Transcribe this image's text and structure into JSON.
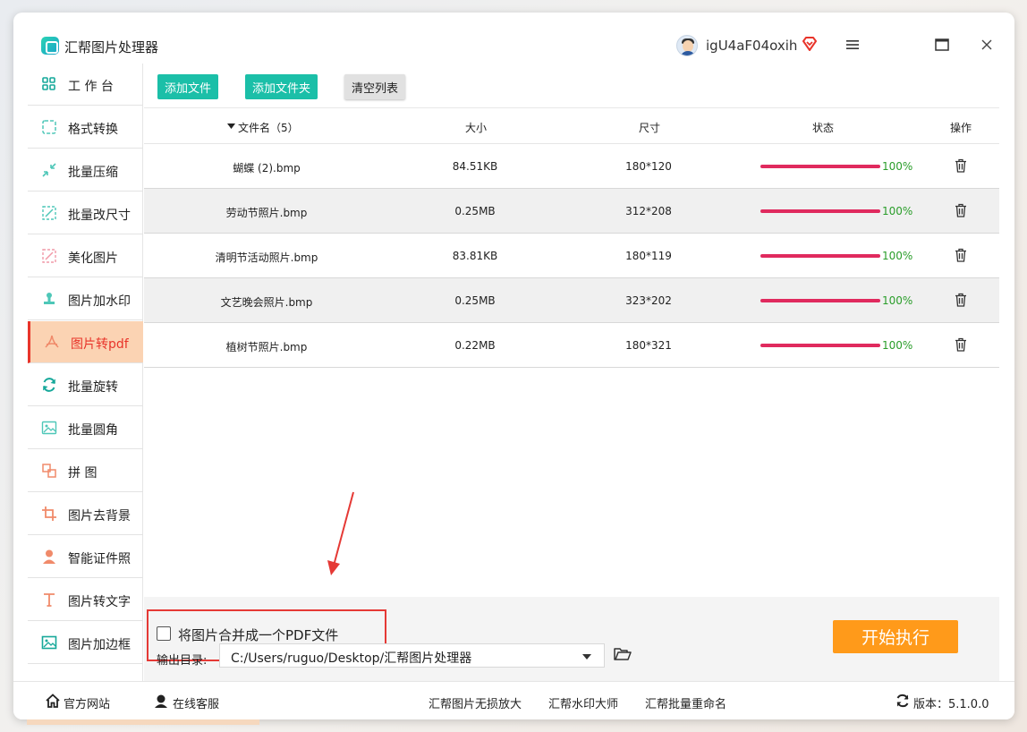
{
  "window": {
    "title": "汇帮图片处理器",
    "username": "igU4aF04oxih"
  },
  "sidebar": {
    "items": [
      {
        "label": "工 作 台",
        "icon": "grid-icon"
      },
      {
        "label": "格式转换",
        "icon": "convert-icon"
      },
      {
        "label": "批量压缩",
        "icon": "compress-icon"
      },
      {
        "label": "批量改尺寸",
        "icon": "resize-icon"
      },
      {
        "label": "美化图片",
        "icon": "beautify-icon"
      },
      {
        "label": "图片加水印",
        "icon": "watermark-icon"
      },
      {
        "label": "图片转pdf",
        "icon": "pdf-icon"
      },
      {
        "label": "批量旋转",
        "icon": "rotate-icon"
      },
      {
        "label": "批量圆角",
        "icon": "round-corner-icon"
      },
      {
        "label": "拼   图",
        "icon": "puzzle-icon"
      },
      {
        "label": "图片去背景",
        "icon": "crop-icon"
      },
      {
        "label": "智能证件照",
        "icon": "person-icon"
      },
      {
        "label": "图片转文字",
        "icon": "text-icon"
      },
      {
        "label": "图片加边框",
        "icon": "frame-icon"
      }
    ],
    "active_index": 6
  },
  "toolbar": {
    "add_file": "添加文件",
    "add_folder": "添加文件夹",
    "clear_list": "清空列表"
  },
  "table": {
    "headers": {
      "name": "文件名（5）",
      "size": "大小",
      "dimension": "尺寸",
      "status": "状态",
      "action": "操作"
    },
    "rows": [
      {
        "name": "蝴蝶 (2).bmp",
        "size": "84.51KB",
        "dimension": "180*120",
        "progress": "100%"
      },
      {
        "name": "劳动节照片.bmp",
        "size": "0.25MB",
        "dimension": "312*208",
        "progress": "100%"
      },
      {
        "name": "清明节活动照片.bmp",
        "size": "83.81KB",
        "dimension": "180*119",
        "progress": "100%"
      },
      {
        "name": "文艺晚会照片.bmp",
        "size": "0.25MB",
        "dimension": "323*202",
        "progress": "100%"
      },
      {
        "name": "植树节照片.bmp",
        "size": "0.22MB",
        "dimension": "180*321",
        "progress": "100%"
      }
    ]
  },
  "options": {
    "merge_label": "将图片合并成一个PDF文件",
    "merge_checked": false,
    "output_label": "输出目录:",
    "output_path": "C:/Users/ruguo/Desktop/汇帮图片处理器",
    "start_button": "开始执行"
  },
  "footer": {
    "website": "官方网站",
    "support": "在线客服",
    "link1": "汇帮图片无损放大",
    "link2": "汇帮水印大师",
    "link3": "汇帮批量重命名",
    "version": "版本：5.1.0.0"
  },
  "colors": {
    "accent_teal": "#1bbfa8",
    "active_bg": "#fbd3b3",
    "active_text": "#e8342a",
    "progress": "#e02a5e",
    "start_button": "#ff9a1a"
  }
}
